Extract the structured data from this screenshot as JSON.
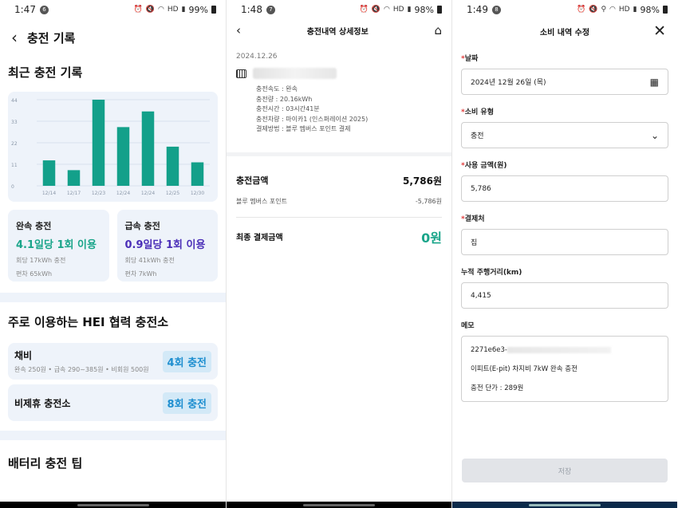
{
  "screen1": {
    "status": {
      "time": "1:47",
      "notif": "6",
      "hd": "HD",
      "battery": "99%"
    },
    "title": "충전 기록",
    "recent_title": "최근 충전 기록",
    "chart_data": {
      "type": "bar",
      "categories": [
        "12/14",
        "12/17",
        "12/23",
        "12/24",
        "12/24",
        "12/25",
        "12/30"
      ],
      "values": [
        13,
        8,
        44,
        30,
        38,
        20,
        12
      ],
      "ylim": [
        0,
        44
      ],
      "yticks": [
        "44",
        "33",
        "22",
        "11",
        "0"
      ],
      "ytick_values": [
        44,
        33,
        22,
        11,
        0
      ],
      "bar_color": "#13a08a",
      "grid": true
    },
    "slow": {
      "title": "완속 충전",
      "main": "4.1일당 1회 이용",
      "sub1": "회당 17kWh 충전",
      "sub2": "편차 65kWh"
    },
    "fast": {
      "title": "급속 충전",
      "main": "0.9일당 1회 이용",
      "sub1": "회당 41kWh 충전",
      "sub2": "편차 7kWh"
    },
    "partner_title": "주로 이용하는 HEI 협력 충전소",
    "partners": [
      {
        "name": "채비",
        "sub": "완속 250원 • 급속 290~385원 • 비회원 500원",
        "badge": "4회 충전"
      },
      {
        "name": "비제휴 충전소",
        "sub": "",
        "badge": "8회 충전"
      }
    ],
    "tips_title": "배터리 충전 팁"
  },
  "screen2": {
    "status": {
      "time": "1:48",
      "notif": "7",
      "hd": "HD",
      "battery": "98%"
    },
    "title": "충전내역 상세정보",
    "date": "2024.12.26",
    "details": [
      "충전속도 : 완속",
      "충전량 : 20.16kWh",
      "충전시간 : 03시간41분",
      "충전차량 : 마이카1 (인스퍼레이션 2025)",
      "결제방법 : 블루 멤버스 포인트 결제"
    ],
    "charge_label": "충전금액",
    "charge_value": "5,786원",
    "points_label": "블루 멤버스 포인트",
    "points_value": "-5,786원",
    "final_label": "최종 결제금액",
    "final_value": "0원"
  },
  "screen3": {
    "status": {
      "time": "1:49",
      "notif": "8",
      "hd": "HD",
      "battery": "98%"
    },
    "title": "소비 내역 수정",
    "fields": {
      "date": {
        "label": "날짜",
        "value": "2024년 12월 26일 (목)"
      },
      "type": {
        "label": "소비 유형",
        "value": "충전"
      },
      "amount": {
        "label": "사용 금액(원)",
        "value": "5,786"
      },
      "place": {
        "label": "결제처",
        "value": "집"
      },
      "mileage": {
        "label": "누적 주행거리(km)",
        "value": "4,415"
      },
      "memo": {
        "label": "메모",
        "line1": "2271e6e3-",
        "line2": "이피트(E-pit) 차지비 7kW 완속 충전",
        "line3": "충전 단가 : 289원"
      }
    },
    "required_mark": "*",
    "save_label": "저장"
  }
}
